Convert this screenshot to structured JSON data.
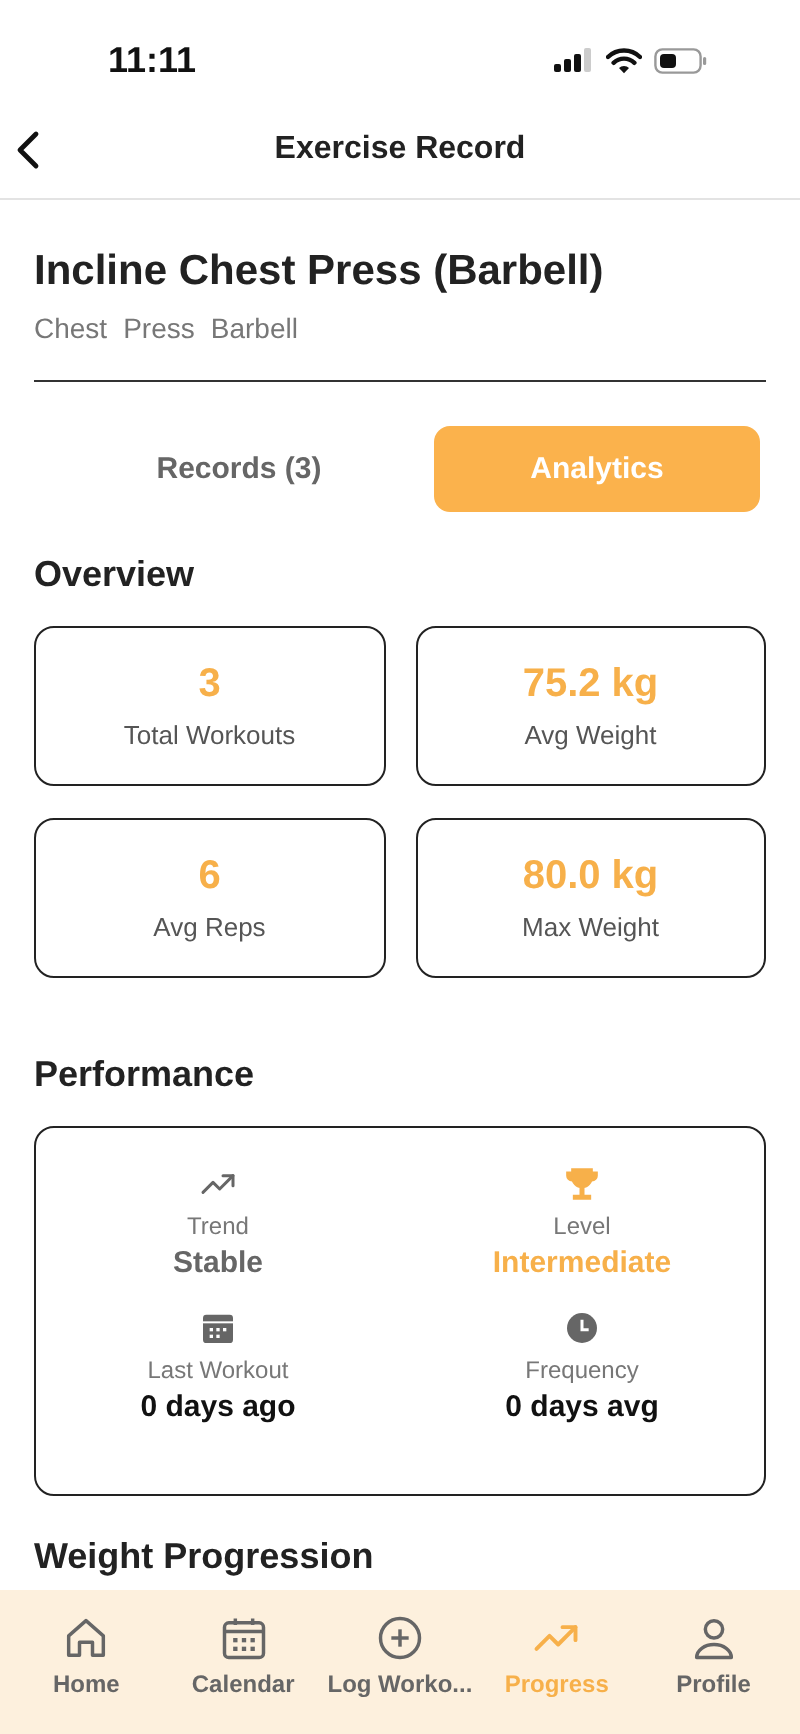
{
  "status_bar": {
    "time": "11:11"
  },
  "nav": {
    "title": "Exercise Record"
  },
  "exercise": {
    "name": "Incline Chest Press (Barbell)",
    "tags": [
      "Chest",
      "Press",
      "Barbell"
    ]
  },
  "tabs": [
    {
      "label": "Records (3)",
      "selected": false
    },
    {
      "label": "Analytics",
      "selected": true
    }
  ],
  "overview": {
    "title": "Overview",
    "stats": [
      {
        "value": "3",
        "label": "Total Workouts"
      },
      {
        "value": "75.2 kg",
        "label": "Avg Weight"
      },
      {
        "value": "6",
        "label": "Avg Reps"
      },
      {
        "value": "80.0 kg",
        "label": "Max Weight"
      }
    ]
  },
  "performance": {
    "title": "Performance",
    "items": [
      {
        "kind": "trend",
        "label": "Trend",
        "value": "Stable",
        "highlight": false
      },
      {
        "kind": "trophy",
        "label": "Level",
        "value": "Intermediate",
        "highlight": true
      },
      {
        "kind": "calendar",
        "label": "Last Workout",
        "value": "0 days ago",
        "highlight": false
      },
      {
        "kind": "clock",
        "label": "Frequency",
        "value": "0 days avg",
        "highlight": false
      }
    ]
  },
  "next_section": {
    "title": "Weight Progression"
  },
  "tab_bar": [
    {
      "kind": "home",
      "label": "Home",
      "selected": false
    },
    {
      "kind": "calendar",
      "label": "Calendar",
      "selected": false
    },
    {
      "kind": "plus",
      "label": "Log Worko...",
      "selected": false
    },
    {
      "kind": "trend",
      "label": "Progress",
      "selected": true
    },
    {
      "kind": "person",
      "label": "Profile",
      "selected": false
    }
  ]
}
